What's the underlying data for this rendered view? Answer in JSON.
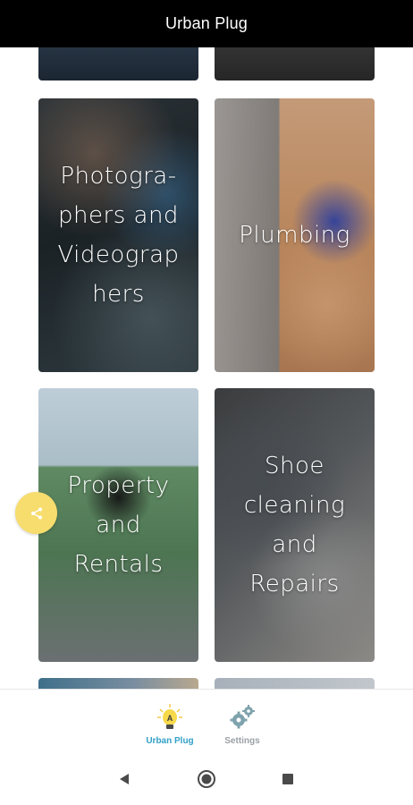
{
  "app": {
    "title": "Urban Plug"
  },
  "categories": [
    {
      "label": ""
    },
    {
      "label": ""
    },
    {
      "label": "Photogra-\nphers and\nVideograp\nhers"
    },
    {
      "label": "Plumbing"
    },
    {
      "label": "Property\nand\nRentals"
    },
    {
      "label": "Shoe\ncleaning\nand\nRepairs"
    },
    {
      "label": ""
    },
    {
      "label": ""
    }
  ],
  "fab": {
    "icon": "share-icon",
    "color": "#f7dd6e"
  },
  "bottom_nav": {
    "items": [
      {
        "label": "Urban Plug",
        "icon": "urban-plug-bulb-icon",
        "active": true
      },
      {
        "label": "Settings",
        "icon": "settings-gears-icon",
        "active": false
      }
    ],
    "active_color": "#33a1c7",
    "inactive_color": "#9aa1a6"
  },
  "system_nav": {
    "icons": [
      "back-triangle-icon",
      "home-circle-icon",
      "recents-square-icon"
    ]
  }
}
